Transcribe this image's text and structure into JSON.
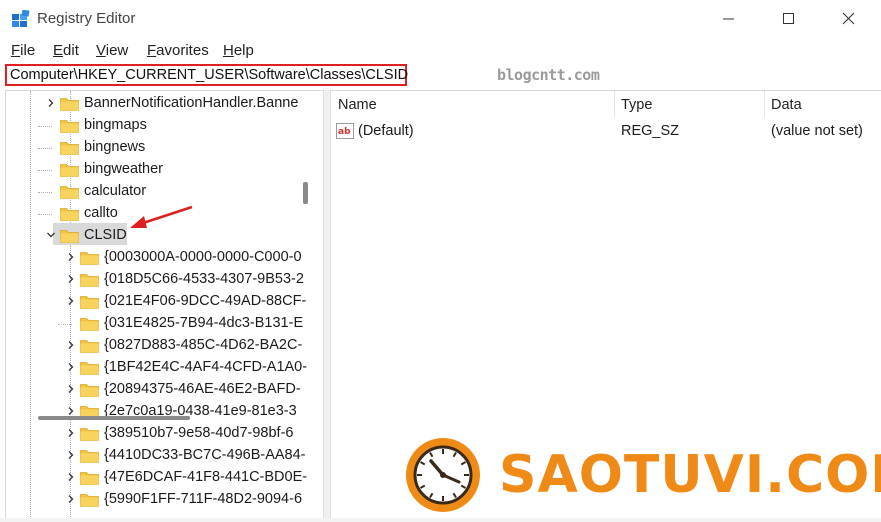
{
  "window": {
    "title": "Registry Editor",
    "controls": [
      "minimize",
      "maximize",
      "close"
    ]
  },
  "menu": [
    {
      "accel": "F",
      "rest": "ile"
    },
    {
      "accel": "E",
      "rest": "dit"
    },
    {
      "accel": "V",
      "rest": "iew"
    },
    {
      "accel": "F",
      "rest": "avorites"
    },
    {
      "accel": "H",
      "rest": "elp"
    }
  ],
  "address": {
    "path": "Computer\\HKEY_CURRENT_USER\\Software\\Classes\\CLSID"
  },
  "watermark_top": "blogcntt.com",
  "tree": {
    "siblings_above": [
      {
        "label": "BannerNotificationHandler.Banne",
        "expandable": true
      },
      {
        "label": "bingmaps",
        "expandable": false
      },
      {
        "label": "bingnews",
        "expandable": false
      },
      {
        "label": "bingweather",
        "expandable": false
      },
      {
        "label": "calculator",
        "expandable": false
      },
      {
        "label": "callto",
        "expandable": false
      }
    ],
    "selected": {
      "label": "CLSID",
      "expanded": true
    },
    "children": [
      {
        "label": "{0003000A-0000-0000-C000-0",
        "expandable": true
      },
      {
        "label": "{018D5C66-4533-4307-9B53-2",
        "expandable": true
      },
      {
        "label": "{021E4F06-9DCC-49AD-88CF-",
        "expandable": true
      },
      {
        "label": "{031E4825-7B94-4dc3-B131-E",
        "expandable": false
      },
      {
        "label": "{0827D883-485C-4D62-BA2C-",
        "expandable": true
      },
      {
        "label": "{1BF42E4C-4AF4-4CFD-A1A0-",
        "expandable": true
      },
      {
        "label": "{20894375-46AE-46E2-BAFD-",
        "expandable": true
      },
      {
        "label": "{2e7c0a19-0438-41e9-81e3-3",
        "expandable": true
      },
      {
        "label": "{389510b7-9e58-40d7-98bf-6",
        "expandable": true
      },
      {
        "label": "{4410DC33-BC7C-496B-AA84-",
        "expandable": true
      },
      {
        "label": "{47E6DCAF-41F8-441C-BD0E-",
        "expandable": true
      },
      {
        "label": "{5990F1FF-711F-48D2-9094-6",
        "expandable": true
      }
    ]
  },
  "list": {
    "columns": [
      "Name",
      "Type",
      "Data"
    ],
    "rows": [
      {
        "name": "(Default)",
        "type": "REG_SZ",
        "data": "(value not set)",
        "icon": "reg-string-icon"
      }
    ]
  },
  "brand": {
    "text": "SAOTUVI.COM",
    "color": "#f08a16",
    "icon": "clock-icon"
  },
  "colors": {
    "highlight_box": "#e02020",
    "selection": "#d9d9d9",
    "folder": "#f5c542"
  }
}
